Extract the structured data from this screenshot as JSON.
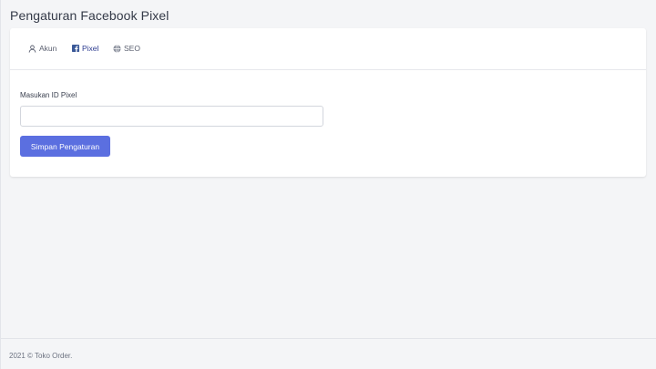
{
  "page": {
    "title": "Pengaturan Facebook Pixel"
  },
  "tabs": [
    {
      "label": "Akun",
      "icon": "user-icon",
      "active": false
    },
    {
      "label": "Pixel",
      "icon": "facebook-icon",
      "active": true
    },
    {
      "label": "SEO",
      "icon": "globe-icon",
      "active": false
    }
  ],
  "form": {
    "pixel_label": "Masukan ID Pixel",
    "pixel_value": "",
    "pixel_placeholder": "",
    "save_label": "Simpan Pengaturan"
  },
  "footer": {
    "text": "2021 © Toko Order."
  },
  "colors": {
    "accent": "#5b6fe0",
    "active_tab": "#2b3a8f",
    "facebook": "#3b5998",
    "background": "#f4f5f7"
  }
}
